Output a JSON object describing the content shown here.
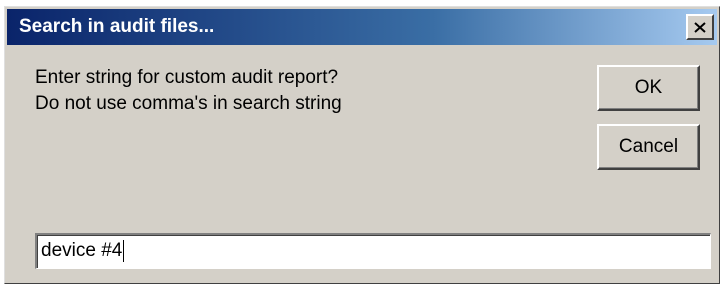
{
  "dialog": {
    "title": "Search in audit files...",
    "close_icon": "close-icon",
    "prompt_line1": "Enter string for custom audit report?",
    "prompt_line2": "Do not use comma's in search string",
    "ok_label": "OK",
    "cancel_label": "Cancel",
    "input_value": "device #4"
  }
}
